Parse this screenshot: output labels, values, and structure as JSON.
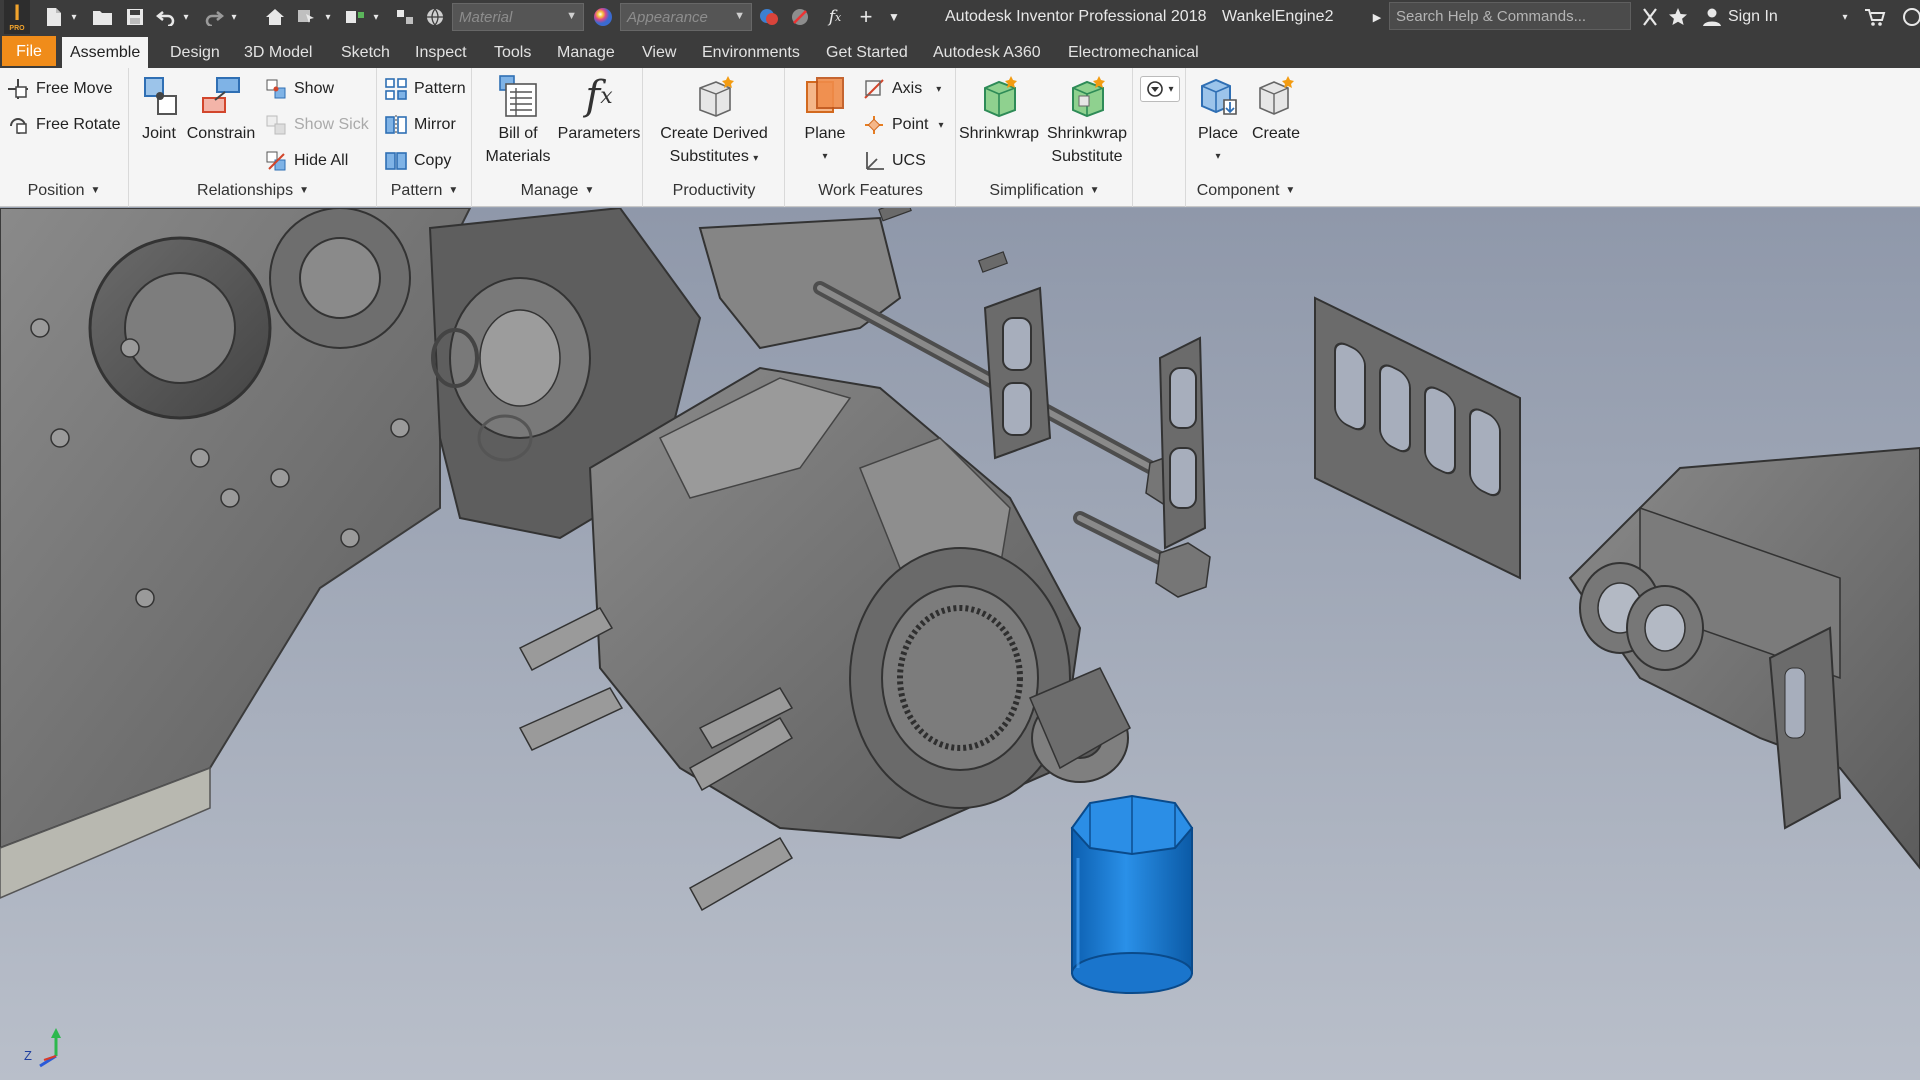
{
  "titlebar": {
    "app_title": "Autodesk Inventor Professional 2018",
    "document_name": "WankelEngine2",
    "material_placeholder": "Material",
    "appearance_placeholder": "Appearance",
    "search_placeholder": "Search Help & Commands...",
    "sign_in": "Sign In",
    "logo_text": "PRO"
  },
  "tabs": [
    {
      "label": "File"
    },
    {
      "label": "Assemble"
    },
    {
      "label": "Design"
    },
    {
      "label": "3D Model"
    },
    {
      "label": "Sketch"
    },
    {
      "label": "Inspect"
    },
    {
      "label": "Tools"
    },
    {
      "label": "Manage"
    },
    {
      "label": "View"
    },
    {
      "label": "Environments"
    },
    {
      "label": "Get Started"
    },
    {
      "label": "Autodesk A360"
    },
    {
      "label": "Electromechanical"
    }
  ],
  "active_tab": "Assemble",
  "ribbon": {
    "position": {
      "label": "Position",
      "free_move": "Free Move",
      "free_rotate": "Free Rotate"
    },
    "relationships": {
      "label": "Relationships",
      "joint": "Joint",
      "constrain": "Constrain",
      "show": "Show",
      "show_sick": "Show Sick",
      "hide_all": "Hide All"
    },
    "pattern": {
      "label": "Pattern",
      "pattern": "Pattern",
      "mirror": "Mirror",
      "copy": "Copy"
    },
    "manage": {
      "label": "Manage",
      "bom_line1": "Bill of",
      "bom_line2": "Materials",
      "parameters": "Parameters"
    },
    "productivity": {
      "label": "Productivity",
      "derived_line1": "Create Derived",
      "derived_line2": "Substitutes"
    },
    "work_features": {
      "label": "Work Features",
      "plane": "Plane",
      "axis": "Axis",
      "point": "Point",
      "ucs": "UCS"
    },
    "simplification": {
      "label": "Simplification",
      "shrinkwrap": "Shrinkwrap",
      "shrinkwrap_sub_line1": "Shrinkwrap",
      "shrinkwrap_sub_line2": "Substitute"
    },
    "component": {
      "label": "Component",
      "place": "Place",
      "create": "Create"
    }
  },
  "viewport": {
    "axis_label": "Z",
    "colors": {
      "background_top": "#8f98aa",
      "background_bottom": "#b9bfca",
      "selected_part": "#1e7fd6",
      "part_gray": "#6e6e6e"
    }
  }
}
